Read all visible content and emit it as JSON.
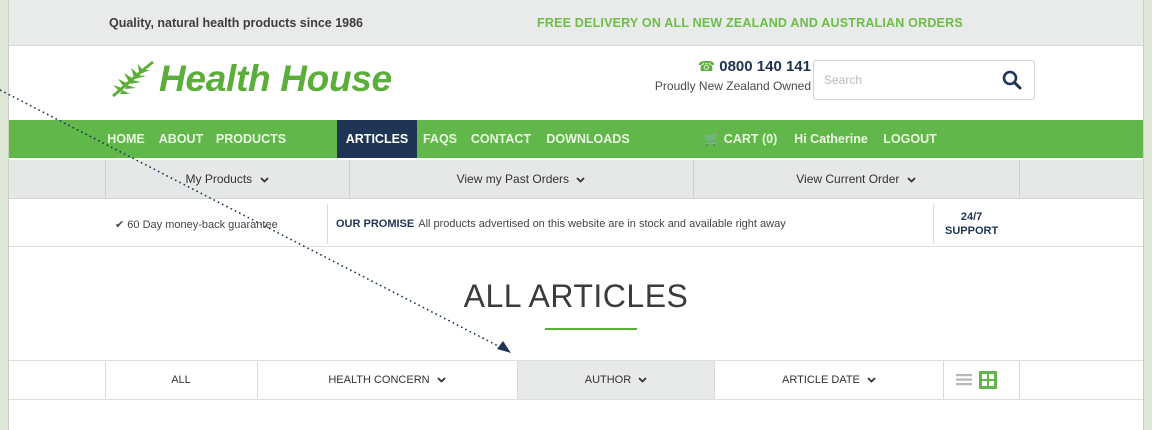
{
  "top_strip": {
    "tagline": "Quality, natural health products since 1986",
    "delivery": "FREE DELIVERY ON ALL NEW ZEALAND AND AUSTRALIAN ORDERS"
  },
  "header": {
    "logo_text": "Health House",
    "phone": "0800 140 141",
    "owned": "Proudly New Zealand Owned",
    "search_placeholder": "Search"
  },
  "nav": {
    "items": [
      "HOME",
      "ABOUT",
      "PRODUCTS",
      "ARTICLES",
      "FAQS",
      "CONTACT",
      "DOWNLOADS",
      "CART (0)",
      "Hi Catherine",
      "LOGOUT"
    ],
    "active": "ARTICLES"
  },
  "subnav": {
    "items": [
      "My Products",
      "View my Past Orders",
      "View Current Order"
    ]
  },
  "promise": {
    "guarantee": "60 Day money-back guarantee",
    "promise_label": "OUR PROMISE",
    "promise_text": "All products advertised on this website are in stock and available right away",
    "support_line1": "24/7",
    "support_line2": "SUPPORT"
  },
  "page": {
    "title": "ALL ARTICLES"
  },
  "filters": {
    "items": [
      "ALL",
      "HEALTH CONCERN",
      "AUTHOR",
      "ARTICLE DATE"
    ],
    "active": "AUTHOR"
  },
  "colors": {
    "brand_green": "#62b74a",
    "navy": "#1f3556"
  }
}
